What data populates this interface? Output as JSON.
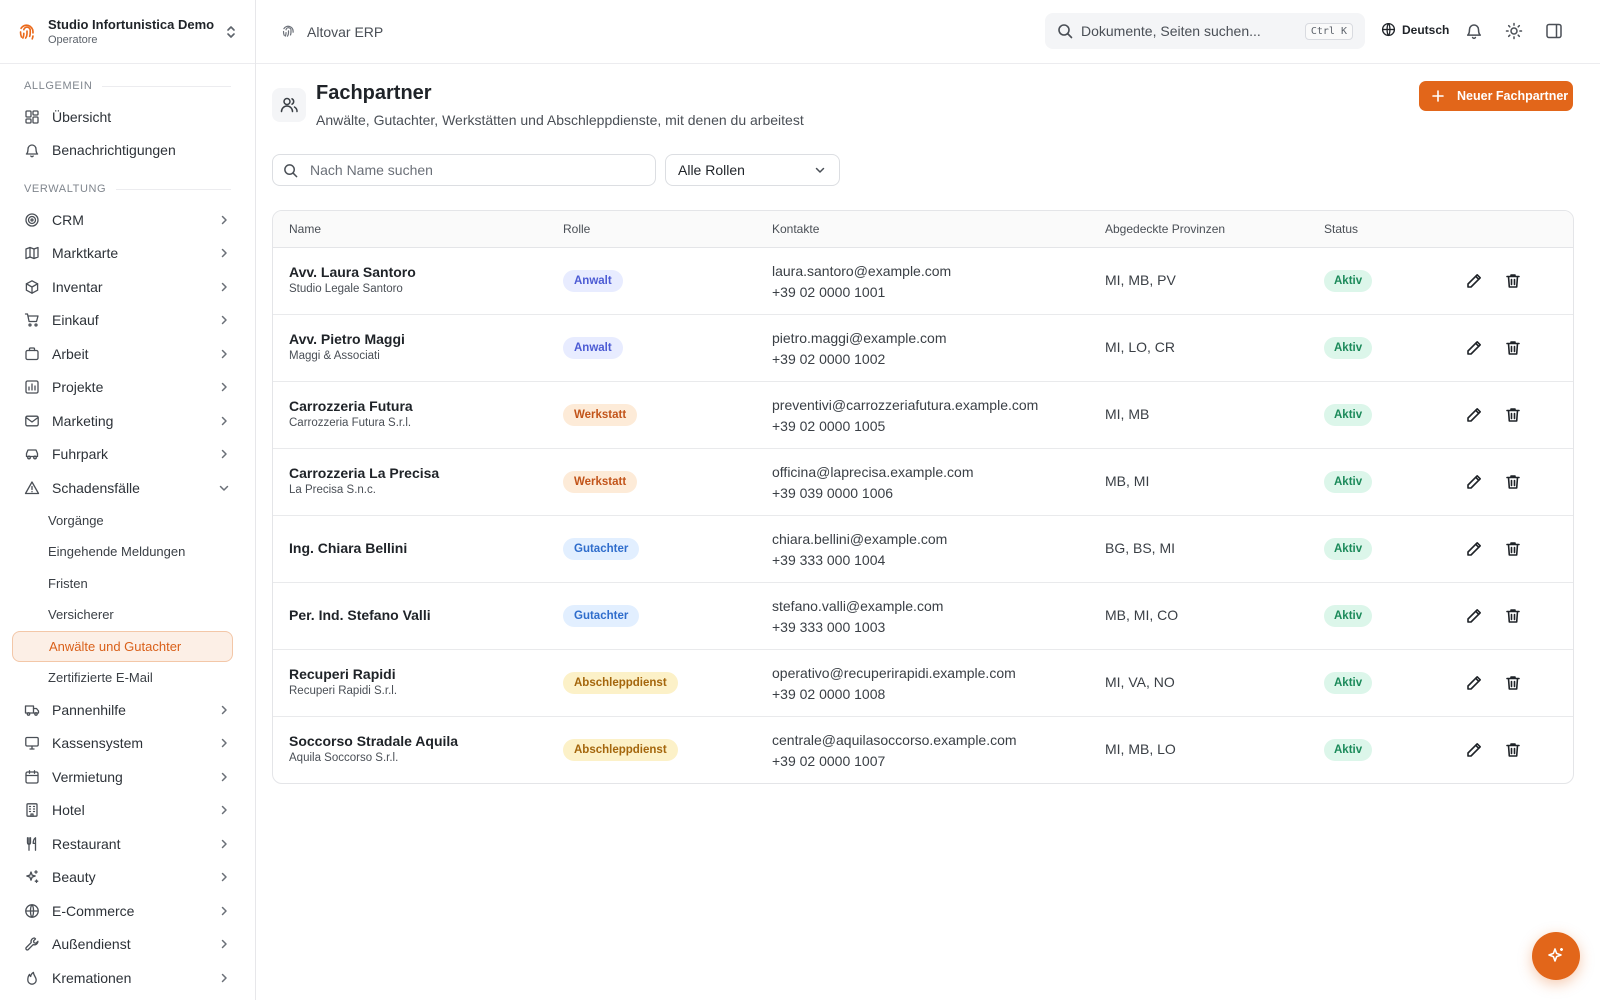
{
  "org": {
    "name": "Studio Infortunistica Demo",
    "role": "Operatore"
  },
  "sidebar": {
    "sections": [
      {
        "title": "Allgemein"
      },
      {
        "title": "Verwaltung"
      }
    ],
    "general": [
      {
        "label": "Übersicht",
        "icon": "dashboard-icon"
      },
      {
        "label": "Benachrichtigungen",
        "icon": "bell-icon"
      }
    ],
    "admin_top": [
      {
        "label": "CRM",
        "icon": "target-icon"
      },
      {
        "label": "Marktkarte",
        "icon": "map-icon"
      },
      {
        "label": "Inventar",
        "icon": "box-icon"
      },
      {
        "label": "Einkauf",
        "icon": "cart-icon"
      },
      {
        "label": "Arbeit",
        "icon": "briefcase-icon"
      },
      {
        "label": "Projekte",
        "icon": "chart-icon"
      },
      {
        "label": "Marketing",
        "icon": "mail-icon"
      },
      {
        "label": "Fuhrpark",
        "icon": "car-icon"
      }
    ],
    "claims": {
      "label": "Schadensfälle",
      "icon": "warning-icon"
    },
    "claims_sub": [
      "Vorgänge",
      "Eingehende Meldungen",
      "Fristen",
      "Versicherer",
      "Anwälte und Gutachter",
      "Zertifizierte E-Mail"
    ],
    "claims_active": "Anwälte und Gutachter",
    "admin_bottom": [
      {
        "label": "Pannenhilfe",
        "icon": "truck-icon"
      },
      {
        "label": "Kassensystem",
        "icon": "monitor-icon"
      },
      {
        "label": "Vermietung",
        "icon": "calendar-icon"
      },
      {
        "label": "Hotel",
        "icon": "building-icon"
      },
      {
        "label": "Restaurant",
        "icon": "utensils-icon"
      },
      {
        "label": "Beauty",
        "icon": "sparkles-icon"
      },
      {
        "label": "E-Commerce",
        "icon": "globe-icon"
      },
      {
        "label": "Außendienst",
        "icon": "wrench-icon"
      },
      {
        "label": "Kremationen",
        "icon": "flame-icon"
      }
    ]
  },
  "topbar": {
    "app_name": "Altovar ERP",
    "search_placeholder": "Dokumente, Seiten suchen...",
    "search_shortcut": "Ctrl K",
    "language": "Deutsch"
  },
  "page": {
    "title": "Fachpartner",
    "subtitle": "Anwälte, Gutachter, Werkstätten und Abschleppdienste, mit denen du arbeitest",
    "new_button": "Neuer Fachpartner",
    "search_placeholder": "Nach Name suchen",
    "role_filter": "Alle Rollen"
  },
  "table": {
    "columns": [
      "Name",
      "Rolle",
      "Kontakte",
      "Abgedeckte Provinzen",
      "Status"
    ],
    "rows": [
      {
        "name": "Avv. Laura Santoro",
        "org": "Studio Legale Santoro",
        "role": "Anwalt",
        "role_kind": "anwalt",
        "email": "laura.santoro@example.com",
        "phone": "+39 02 0000 1001",
        "provinces": "MI, MB, PV",
        "status": "Aktiv"
      },
      {
        "name": "Avv. Pietro Maggi",
        "org": "Maggi & Associati",
        "role": "Anwalt",
        "role_kind": "anwalt",
        "email": "pietro.maggi@example.com",
        "phone": "+39 02 0000 1002",
        "provinces": "MI, LO, CR",
        "status": "Aktiv"
      },
      {
        "name": "Carrozzeria Futura",
        "org": "Carrozzeria Futura S.r.l.",
        "role": "Werkstatt",
        "role_kind": "werkstatt",
        "email": "preventivi@carrozzeriafutura.example.com",
        "phone": "+39 02 0000 1005",
        "provinces": "MI, MB",
        "status": "Aktiv"
      },
      {
        "name": "Carrozzeria La Precisa",
        "org": "La Precisa S.n.c.",
        "role": "Werkstatt",
        "role_kind": "werkstatt",
        "email": "officina@laprecisa.example.com",
        "phone": "+39 039 0000 1006",
        "provinces": "MB, MI",
        "status": "Aktiv"
      },
      {
        "name": "Ing. Chiara Bellini",
        "org": "",
        "role": "Gutachter",
        "role_kind": "gutachter",
        "email": "chiara.bellini@example.com",
        "phone": "+39 333 000 1004",
        "provinces": "BG, BS, MI",
        "status": "Aktiv"
      },
      {
        "name": "Per. Ind. Stefano Valli",
        "org": "",
        "role": "Gutachter",
        "role_kind": "gutachter",
        "email": "stefano.valli@example.com",
        "phone": "+39 333 000 1003",
        "provinces": "MB, MI, CO",
        "status": "Aktiv"
      },
      {
        "name": "Recuperi Rapidi",
        "org": "Recuperi Rapidi S.r.l.",
        "role": "Abschleppdienst",
        "role_kind": "abschlepp",
        "email": "operativo@recuperirapidi.example.com",
        "phone": "+39 02 0000 1008",
        "provinces": "MI, VA, NO",
        "status": "Aktiv"
      },
      {
        "name": "Soccorso Stradale Aquila",
        "org": "Aquila Soccorso S.r.l.",
        "role": "Abschleppdienst",
        "role_kind": "abschlepp",
        "email": "centrale@aquilasoccorso.example.com",
        "phone": "+39 02 0000 1007",
        "provinces": "MI, MB, LO",
        "status": "Aktiv"
      }
    ]
  },
  "colors": {
    "accent": "#e2661a",
    "active_bg": "#fcefe6",
    "status_green": "#1b8a5a"
  }
}
